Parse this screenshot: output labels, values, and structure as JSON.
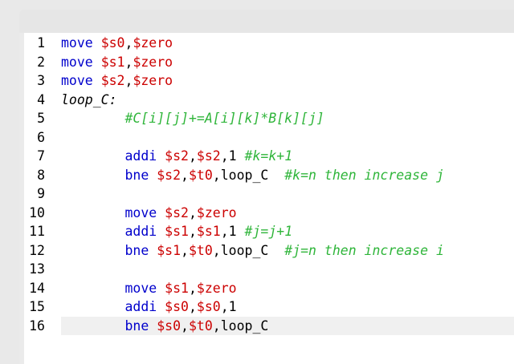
{
  "colors": {
    "keyword": "#0000cc",
    "register": "#cc0000",
    "comment": "#2fb53a",
    "text": "#000000",
    "current_line_bg": "#f0f0f0"
  },
  "editor": {
    "current_line": 16,
    "lines": [
      {
        "no": "1",
        "indent": "",
        "tokens": [
          {
            "t": "kw",
            "v": "move"
          },
          {
            "t": "sp",
            "v": " "
          },
          {
            "t": "reg",
            "v": "$s0"
          },
          {
            "t": "punct",
            "v": ","
          },
          {
            "t": "reg",
            "v": "$zero"
          }
        ]
      },
      {
        "no": "2",
        "indent": "",
        "tokens": [
          {
            "t": "kw",
            "v": "move"
          },
          {
            "t": "sp",
            "v": " "
          },
          {
            "t": "reg",
            "v": "$s1"
          },
          {
            "t": "punct",
            "v": ","
          },
          {
            "t": "reg",
            "v": "$zero"
          }
        ]
      },
      {
        "no": "3",
        "indent": "",
        "tokens": [
          {
            "t": "kw",
            "v": "move"
          },
          {
            "t": "sp",
            "v": " "
          },
          {
            "t": "reg",
            "v": "$s2"
          },
          {
            "t": "punct",
            "v": ","
          },
          {
            "t": "reg",
            "v": "$zero"
          }
        ]
      },
      {
        "no": "4",
        "indent": "",
        "tokens": [
          {
            "t": "labeldef",
            "v": "loop_C:"
          }
        ]
      },
      {
        "no": "5",
        "indent": "        ",
        "tokens": [
          {
            "t": "comment",
            "v": "#C[i][j]+=A[i][k]*B[k][j]"
          }
        ]
      },
      {
        "no": "6",
        "indent": "",
        "tokens": []
      },
      {
        "no": "7",
        "indent": "        ",
        "tokens": [
          {
            "t": "kw",
            "v": "addi"
          },
          {
            "t": "sp",
            "v": " "
          },
          {
            "t": "reg",
            "v": "$s2"
          },
          {
            "t": "punct",
            "v": ","
          },
          {
            "t": "reg",
            "v": "$s2"
          },
          {
            "t": "punct",
            "v": ","
          },
          {
            "t": "num",
            "v": "1"
          },
          {
            "t": "sp",
            "v": " "
          },
          {
            "t": "comment",
            "v": "#k=k+1"
          }
        ]
      },
      {
        "no": "8",
        "indent": "        ",
        "tokens": [
          {
            "t": "kw",
            "v": "bne"
          },
          {
            "t": "sp",
            "v": " "
          },
          {
            "t": "reg",
            "v": "$s2"
          },
          {
            "t": "punct",
            "v": ","
          },
          {
            "t": "reg",
            "v": "$t0"
          },
          {
            "t": "punct",
            "v": ","
          },
          {
            "t": "label",
            "v": "loop_C"
          },
          {
            "t": "sp",
            "v": "  "
          },
          {
            "t": "comment",
            "v": "#k=n then increase j"
          }
        ]
      },
      {
        "no": "9",
        "indent": "",
        "tokens": []
      },
      {
        "no": "10",
        "indent": "        ",
        "tokens": [
          {
            "t": "kw",
            "v": "move"
          },
          {
            "t": "sp",
            "v": " "
          },
          {
            "t": "reg",
            "v": "$s2"
          },
          {
            "t": "punct",
            "v": ","
          },
          {
            "t": "reg",
            "v": "$zero"
          }
        ]
      },
      {
        "no": "11",
        "indent": "        ",
        "tokens": [
          {
            "t": "kw",
            "v": "addi"
          },
          {
            "t": "sp",
            "v": " "
          },
          {
            "t": "reg",
            "v": "$s1"
          },
          {
            "t": "punct",
            "v": ","
          },
          {
            "t": "reg",
            "v": "$s1"
          },
          {
            "t": "punct",
            "v": ","
          },
          {
            "t": "num",
            "v": "1"
          },
          {
            "t": "sp",
            "v": " "
          },
          {
            "t": "comment",
            "v": "#j=j+1"
          }
        ]
      },
      {
        "no": "12",
        "indent": "        ",
        "tokens": [
          {
            "t": "kw",
            "v": "bne"
          },
          {
            "t": "sp",
            "v": " "
          },
          {
            "t": "reg",
            "v": "$s1"
          },
          {
            "t": "punct",
            "v": ","
          },
          {
            "t": "reg",
            "v": "$t0"
          },
          {
            "t": "punct",
            "v": ","
          },
          {
            "t": "label",
            "v": "loop_C"
          },
          {
            "t": "sp",
            "v": "  "
          },
          {
            "t": "comment",
            "v": "#j=n then increase i"
          }
        ]
      },
      {
        "no": "13",
        "indent": "",
        "tokens": []
      },
      {
        "no": "14",
        "indent": "        ",
        "tokens": [
          {
            "t": "kw",
            "v": "move"
          },
          {
            "t": "sp",
            "v": " "
          },
          {
            "t": "reg",
            "v": "$s1"
          },
          {
            "t": "punct",
            "v": ","
          },
          {
            "t": "reg",
            "v": "$zero"
          }
        ]
      },
      {
        "no": "15",
        "indent": "        ",
        "tokens": [
          {
            "t": "kw",
            "v": "addi"
          },
          {
            "t": "sp",
            "v": " "
          },
          {
            "t": "reg",
            "v": "$s0"
          },
          {
            "t": "punct",
            "v": ","
          },
          {
            "t": "reg",
            "v": "$s0"
          },
          {
            "t": "punct",
            "v": ","
          },
          {
            "t": "num",
            "v": "1"
          }
        ]
      },
      {
        "no": "16",
        "indent": "        ",
        "tokens": [
          {
            "t": "kw",
            "v": "bne"
          },
          {
            "t": "sp",
            "v": " "
          },
          {
            "t": "reg",
            "v": "$s0"
          },
          {
            "t": "punct",
            "v": ","
          },
          {
            "t": "reg",
            "v": "$t0"
          },
          {
            "t": "punct",
            "v": ","
          },
          {
            "t": "label",
            "v": "loop_C"
          }
        ]
      }
    ]
  }
}
